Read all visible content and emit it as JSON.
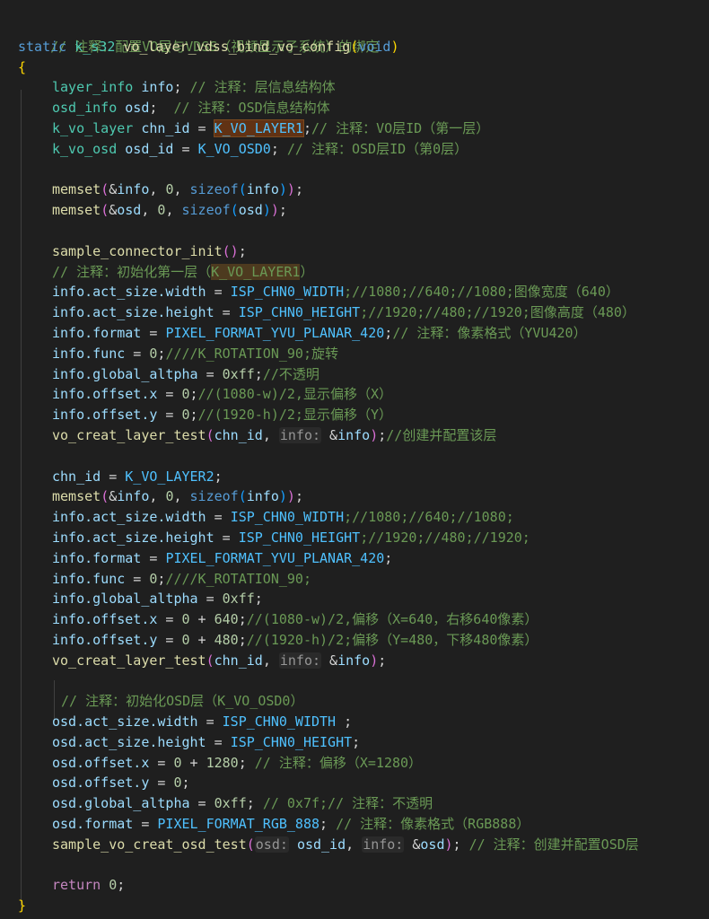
{
  "code": {
    "l0_comment": "// 注释：配置VO层与VDSS（视频显示子系统）的绑定",
    "l1_static": "static",
    "l1_type": "k_s32",
    "l1_fn": "vo_layer_vdss_bind_vo_config",
    "l1_void": "void",
    "l2_brace": "{",
    "l3_type": "layer_info",
    "l3_var": "info",
    "l3_comment": "// 注释：层信息结构体",
    "l4_type": "osd_info",
    "l4_var": "osd",
    "l4_comment": "// 注释：OSD信息结构体",
    "l5_type": "k_vo_layer",
    "l5_var": "chn_id",
    "l5_macro": "K_VO_LAYER1",
    "l5_comment": "// 注释：VO层ID（第一层）",
    "l6_type": "k_vo_osd",
    "l6_var": "osd_id",
    "l6_macro": "K_VO_OSD0",
    "l6_comment": "// 注释：OSD层ID（第0层）",
    "l8_fn": "memset",
    "l8_var": "info",
    "l8_num": "0",
    "l8_kw": "sizeof",
    "l9_fn": "memset",
    "l9_var": "osd",
    "l9_num": "0",
    "l9_kw": "sizeof",
    "l11_fn": "sample_connector_init",
    "l12_comment_a": "// 注释：初始化第一层（",
    "l12_comment_macro": "K_VO_LAYER1",
    "l12_comment_b": "）",
    "l13_var": "info.act_size.width",
    "l13_macro": "ISP_CHN0_WIDTH",
    "l13_comment": ";//1080;//640;//1080;图像宽度（640）",
    "l14_var": "info.act_size.height",
    "l14_macro": "ISP_CHN0_HEIGHT",
    "l14_comment": ";//1920;//480;//1920;图像高度（480）",
    "l15_var": "info.format",
    "l15_macro": "PIXEL_FORMAT_YVU_PLANAR_420",
    "l15_comment": "// 注释：像素格式（YVU420）",
    "l16_var": "info.func",
    "l16_num": "0",
    "l16_comment": "////K_ROTATION_90;旋转",
    "l17_var": "info.global_altpha",
    "l17_num": "0xff",
    "l17_comment": "//不透明",
    "l18_var": "info.offset.x",
    "l18_num": "0",
    "l18_comment": "//(1080-w)/2,显示偏移（X）",
    "l19_var": "info.offset.y",
    "l19_num": "0",
    "l19_comment": "//(1920-h)/2;显示偏移（Y）",
    "l20_fn": "vo_creat_layer_test",
    "l20_var1": "chn_id",
    "l20_hint": "info:",
    "l20_var2": "info",
    "l20_comment": "//创建并配置该层",
    "l22_var": "chn_id",
    "l22_macro": "K_VO_LAYER2",
    "l23_fn": "memset",
    "l23_var": "info",
    "l23_num": "0",
    "l23_kw": "sizeof",
    "l24_var": "info.act_size.width",
    "l24_macro": "ISP_CHN0_WIDTH",
    "l24_comment": ";//1080;//640;//1080;",
    "l25_var": "info.act_size.height",
    "l25_macro": "ISP_CHN0_HEIGHT",
    "l25_comment": ";//1920;//480;//1920;",
    "l26_var": "info.format",
    "l26_macro": "PIXEL_FORMAT_YVU_PLANAR_420",
    "l27_var": "info.func",
    "l27_num": "0",
    "l27_comment": "////K_ROTATION_90;",
    "l28_var": "info.global_altpha",
    "l28_num": "0xff",
    "l29_var": "info.offset.x",
    "l29_num_a": "0",
    "l29_num_b": "640",
    "l29_comment": "//(1080-w)/2,偏移（X=640，右移640像素）",
    "l30_var": "info.offset.y",
    "l30_num_a": "0",
    "l30_num_b": "480",
    "l30_comment": "//(1920-h)/2;偏移（Y=480，下移480像素）",
    "l31_fn": "vo_creat_layer_test",
    "l31_var1": "chn_id",
    "l31_hint": "info:",
    "l31_var2": "info",
    "l33_comment": "// 注释：初始化OSD层（K_VO_OSD0）",
    "l34_var": "osd.act_size.width",
    "l34_macro": "ISP_CHN0_WIDTH",
    "l35_var": "osd.act_size.height",
    "l35_macro": "ISP_CHN0_HEIGHT",
    "l36_var": "osd.offset.x",
    "l36_num_a": "0",
    "l36_num_b": "1280",
    "l36_comment": "// 注释：偏移（X=1280）",
    "l37_var": "osd.offset.y",
    "l37_num": "0",
    "l38_var": "osd.global_altpha",
    "l38_num": "0xff",
    "l38_comment": "// 0x7f;// 注释：不透明",
    "l39_var": "osd.format",
    "l39_macro": "PIXEL_FORMAT_RGB_888",
    "l39_comment": "// 注释：像素格式（RGB888）",
    "l40_fn": "sample_vo_creat_osd_test",
    "l40_hint1": "osd:",
    "l40_var1": "osd_id",
    "l40_hint2": "info:",
    "l40_var2": "osd",
    "l40_comment": "// 注释：创建并配置OSD层",
    "l42_kw": "return",
    "l42_num": "0",
    "l43_brace": "}"
  }
}
